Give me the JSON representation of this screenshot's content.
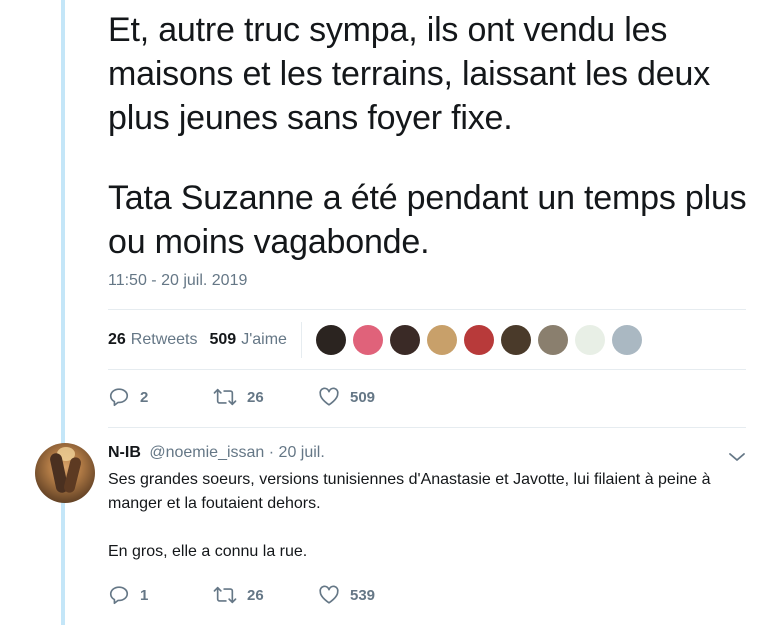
{
  "tweet": {
    "paragraphs": [
      "Et, autre truc sympa, ils ont vendu les maisons et les terrains, laissant les deux plus jeunes sans foyer fixe.",
      "Tata Suzanne a été pendant un temps plus ou moins vagabonde."
    ],
    "timestamp": "11:50 - 20 juil. 2019",
    "retweets_count": "26",
    "retweets_label": "Retweets",
    "likes_count": "509",
    "likes_label": "J'aime",
    "actions": {
      "replies": "2",
      "retweets": "26",
      "likes": "509"
    },
    "liker_avatar_colors": [
      "#2b2420",
      "#e0627a",
      "#3a2a26",
      "#c8a06a",
      "#b83a3a",
      "#4a3a2a",
      "#8a7f6e",
      "#e8efe6",
      "#aab8c2"
    ]
  },
  "reply": {
    "name": "N-IB",
    "handle": "@noemie_issan",
    "date": "· 20 juil.",
    "paragraphs": [
      "Ses grandes soeurs, versions tunisiennes d'Anastasie et Javotte, lui filaient à peine à manger et la foutaient dehors.",
      "En gros, elle a connu la rue."
    ],
    "actions": {
      "replies": "1",
      "retweets": "26",
      "likes": "539"
    }
  },
  "colors": {
    "thread": "#c4e6f8",
    "muted": "#657786",
    "text": "#14171a",
    "divider": "#e6ecf0"
  }
}
